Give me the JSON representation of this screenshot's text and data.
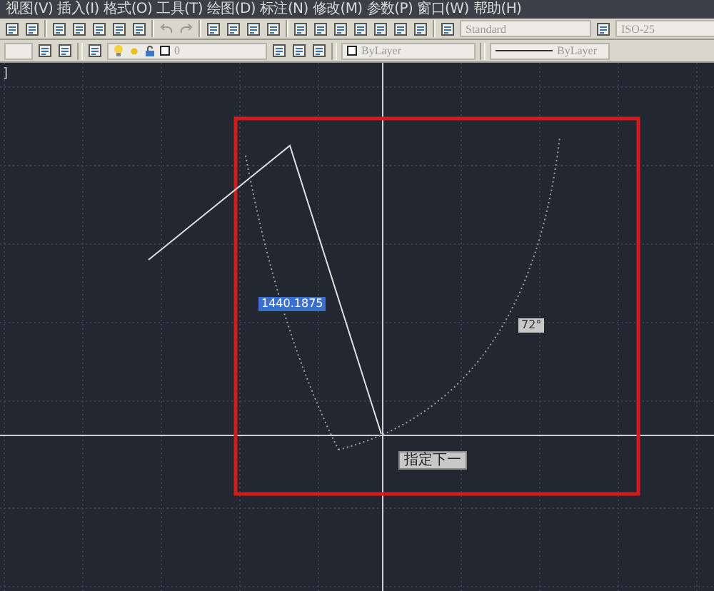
{
  "menu": [
    "视图(V)",
    "插入(I)",
    "格式(O)",
    "工具(T)",
    "绘图(D)",
    "标注(N)",
    "修改(M)",
    "参数(P)",
    "窗口(W)",
    "帮助(H)"
  ],
  "styles": {
    "text_style": "Standard",
    "dim_style": "ISO-25"
  },
  "layers": {
    "current_layer": "0",
    "color_setting": "ByLayer",
    "linetype": "ByLayer"
  },
  "canvas": {
    "viewport_label": "]",
    "length_input": "1440.1875",
    "angle_input": "72°",
    "prompt": "指定下一"
  }
}
